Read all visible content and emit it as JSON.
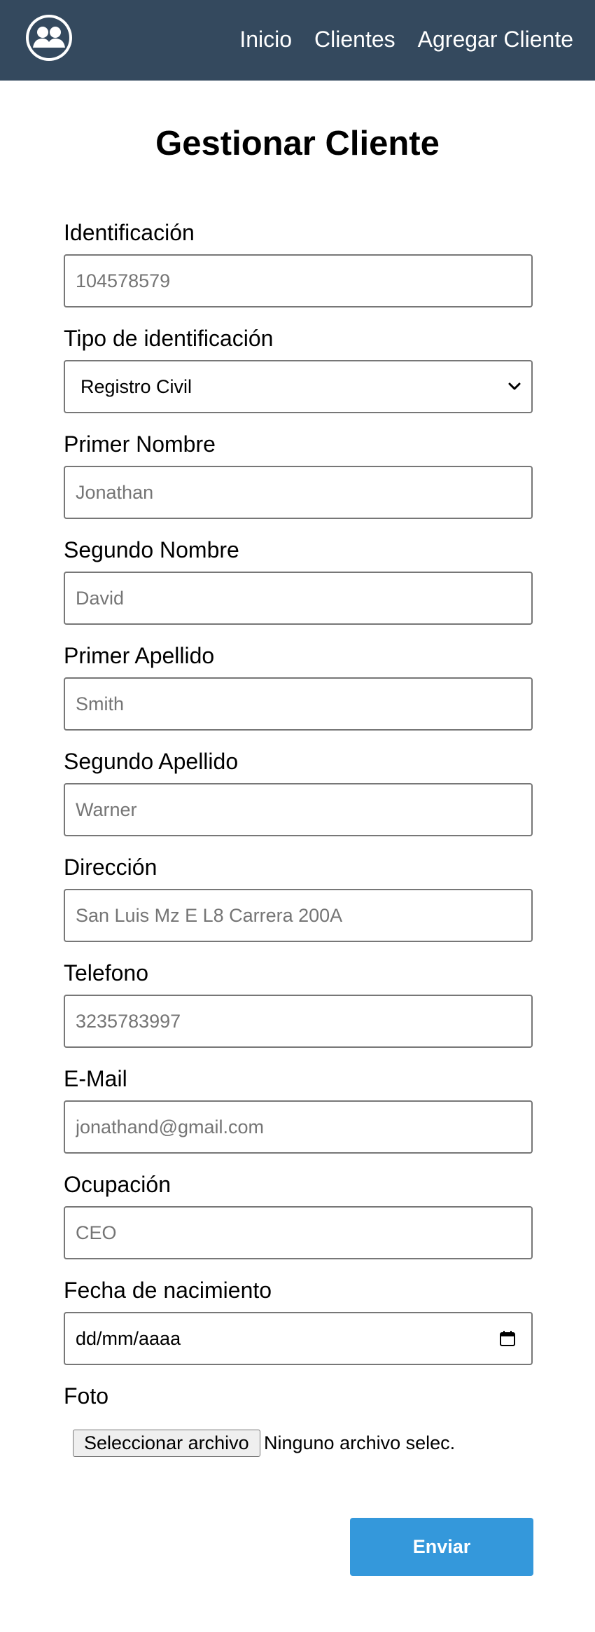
{
  "nav": {
    "logo_icon": "users-group-icon",
    "links": [
      "Inicio",
      "Clientes",
      "Agregar Cliente"
    ],
    "background": "#34495e"
  },
  "page": {
    "title": "Gestionar Cliente"
  },
  "form": {
    "fields": [
      {
        "label": "Identificación",
        "placeholder": "104578579"
      },
      {
        "label": "Tipo de identificación",
        "value": "Registro Civil"
      },
      {
        "label": "Primer Nombre",
        "placeholder": "Jonathan"
      },
      {
        "label": "Segundo Nombre",
        "placeholder": "David"
      },
      {
        "label": "Primer Apellido",
        "placeholder": "Smith"
      },
      {
        "label": "Segundo Apellido",
        "placeholder": "Warner"
      },
      {
        "label": "Dirección",
        "placeholder": "San Luis Mz E L8 Carrera 200A"
      },
      {
        "label": "Telefono",
        "placeholder": "3235783997"
      },
      {
        "label": "E-Mail",
        "placeholder": "jonathand@gmail.com"
      },
      {
        "label": "Ocupación",
        "placeholder": "CEO"
      },
      {
        "label": "Fecha de nacimiento",
        "value": "dd/mm/aaaa"
      },
      {
        "label": "Foto",
        "button": "Seleccionar archivo",
        "status": "Ninguno archivo selec."
      }
    ],
    "submit_label": "Enviar",
    "submit_color": "#3498db"
  }
}
